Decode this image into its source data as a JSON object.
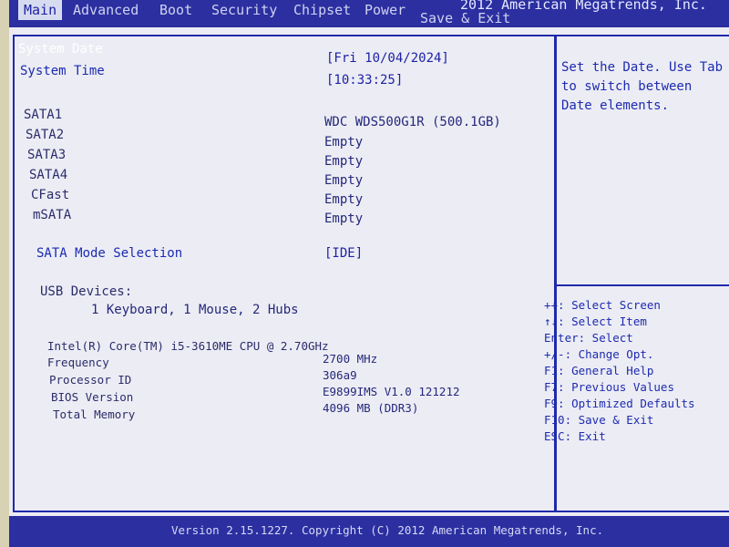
{
  "menu": {
    "tabs": [
      "Main",
      "Advanced",
      "Boot",
      "Security",
      "Chipset",
      "Power",
      "Save & Exit"
    ],
    "copyright_top": "2012 American Megatrends, Inc."
  },
  "main": {
    "system_date_label": "System Date",
    "system_date_value": "[Fri 10/04/2024]",
    "system_time_label": "System Time",
    "system_time_value": "[10:33:25]",
    "sata": [
      {
        "label": "SATA1",
        "value": "WDC  WDS500G1R (500.1GB)"
      },
      {
        "label": "SATA2",
        "value": "Empty"
      },
      {
        "label": "SATA3",
        "value": "Empty"
      },
      {
        "label": "SATA4",
        "value": "Empty"
      },
      {
        "label": "CFast",
        "value": "Empty"
      },
      {
        "label": "mSATA",
        "value": "Empty"
      }
    ],
    "sata_mode_label": "SATA Mode Selection",
    "sata_mode_value": "[IDE]",
    "usb_label": "USB Devices:",
    "usb_value": "1 Keyboard, 1 Mouse, 2 Hubs",
    "cpu_name": "Intel(R) Core(TM) i5-3610ME CPU @ 2.70GHz",
    "info": [
      {
        "label": "Frequency",
        "value": "2700 MHz"
      },
      {
        "label": "Processor ID",
        "value": "306a9"
      },
      {
        "label": "BIOS Version",
        "value": "E9899IMS V1.0 121212"
      },
      {
        "label": "Total Memory",
        "value": "4096 MB (DDR3)"
      }
    ]
  },
  "help": {
    "text": "Set the Date. Use Tab to switch between Date elements.",
    "keys": [
      "++: Select Screen",
      "↑↓: Select Item",
      "Enter: Select",
      "+/-: Change Opt.",
      "F1: General Help",
      "F7: Previous Values",
      "F9: Optimized Defaults",
      "F10: Save & Exit",
      "ESC: Exit"
    ]
  },
  "footer": {
    "text": "Version 2.15.1227. Copyright (C) 2012 American Megatrends, Inc."
  },
  "colors": {
    "bar": "#2b2fa0",
    "background": "#ececf4",
    "border": "#1f2aa8",
    "text": "#24287a"
  }
}
